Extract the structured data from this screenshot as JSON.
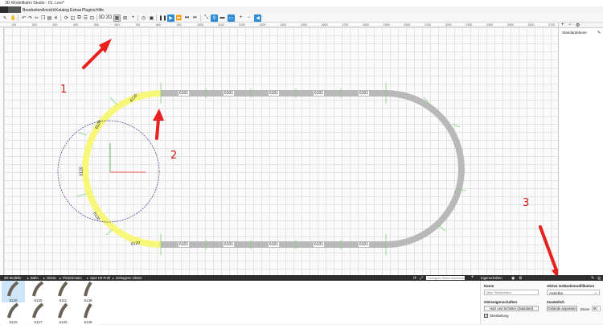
{
  "window": {
    "title": "3D-Modellbahn Studio - 01. Leer*"
  },
  "menu": {
    "items": [
      "Bearbeiten",
      "Ansicht",
      "Katalog",
      "Extras",
      "Plugins",
      "Hilfe"
    ]
  },
  "ruler": {
    "ticks": [
      "100",
      "200",
      "300",
      "400",
      "500",
      "600",
      "700",
      "800",
      "900",
      "1000",
      "1100",
      "1200",
      "1300",
      "1400",
      "1500",
      "1600",
      "1700",
      "1800",
      "1900",
      "2000",
      "2100",
      "2200",
      "2300",
      "2400",
      "2500",
      "2600",
      "2700"
    ]
  },
  "toolbar": {
    "btn_3d": "3D",
    "btn_2d": "2D"
  },
  "layers": {
    "item": "Standardebene"
  },
  "tracks": {
    "straight_top": [
      "6101",
      "6101",
      "6101",
      "6101",
      "6101"
    ],
    "straight_bottom": [
      "6101",
      "6101",
      "6101",
      "6101",
      "6101"
    ],
    "curve_label": "6120"
  },
  "bottom": {
    "breadcrumb": [
      "3D-Modelle",
      "Bahn",
      "Gleise",
      "Fleischmann",
      "Spur H0 Profi",
      "Gebogene Gleise"
    ],
    "search_placeholder": "Gebogene Gleise durchsuchen",
    "properties_tab": "Eigenschaften",
    "catalog": [
      "6120",
      "6125",
      "6111",
      "6138",
      "6122",
      "6127",
      "6133",
      "6139"
    ],
    "name_label": "Name",
    "name_placeholder": "Mein Teilstücktiion",
    "glue_label": "Gleiseigenschaften",
    "glue_button": "Holz und Schotter (Standard)",
    "glue_check": "Gleisbettung",
    "active_label": "Aktive Geländemodifikation",
    "active_value": "Anstellen",
    "extra_label": "Zusätzlich",
    "terrain_button": "Gelände anpassen",
    "width_label": "Breite:",
    "width_value": "60"
  },
  "annotations": {
    "n1": "1",
    "n2": "2",
    "n3": "3"
  },
  "colors": {
    "accent": "#2e8bd6",
    "track": "#b9b9b9",
    "selected_track": "#f7f779",
    "arrow": "#e8201e"
  }
}
